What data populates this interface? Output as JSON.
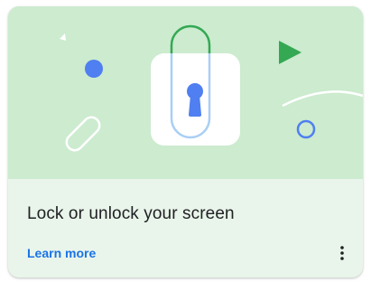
{
  "card": {
    "title": "Lock or unlock your screen",
    "link_label": "Learn more",
    "menu_icon": "more-vert-icon",
    "illustration_icon": "padlock-keyhole-icon"
  },
  "colors": {
    "illustration_bg": "#ccebcf",
    "card_bg": "#e9f5ea",
    "accent_blue": "#4f7ff0",
    "accent_green": "#34a853",
    "title_text": "#202124",
    "link_text": "#1a73e8"
  }
}
